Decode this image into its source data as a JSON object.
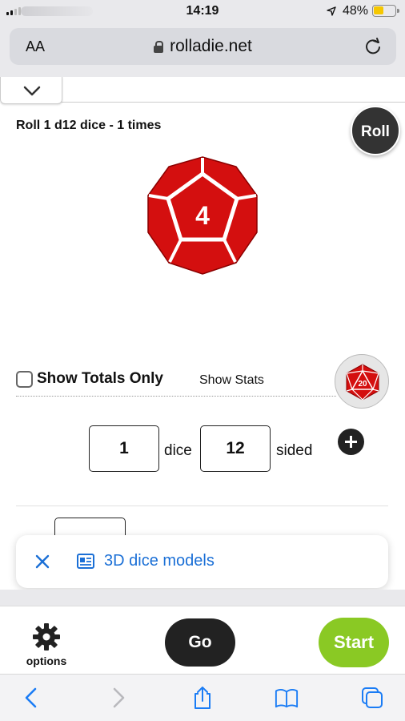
{
  "status_bar": {
    "time": "14:19",
    "battery_percent": "48%",
    "battery_level": 0.48,
    "battery_color": "#f5c700"
  },
  "browser": {
    "text_size_label": "AA",
    "url": "rolladie.net"
  },
  "page": {
    "roll_title": "Roll 1 d12 dice - 1 times",
    "roll_button": "Roll",
    "die_result": "4",
    "die_color": "#d40f0f",
    "show_totals_label": "Show Totals Only",
    "show_totals_checked": false,
    "show_stats_label": "Show Stats",
    "d20_icon_label": "20",
    "dice_count": "1",
    "dice_count_label": "dice",
    "sides": "12",
    "sides_label": "sided"
  },
  "banner": {
    "text": "3D dice models",
    "accent_color": "#1a6fd6"
  },
  "app_bar": {
    "options_label": "options",
    "go_label": "Go",
    "start_label": "Start",
    "start_color": "#8ac924"
  },
  "safari_toolbar": {
    "icons": [
      "back-icon",
      "forward-icon",
      "share-icon",
      "bookmarks-icon",
      "tabs-icon"
    ]
  }
}
